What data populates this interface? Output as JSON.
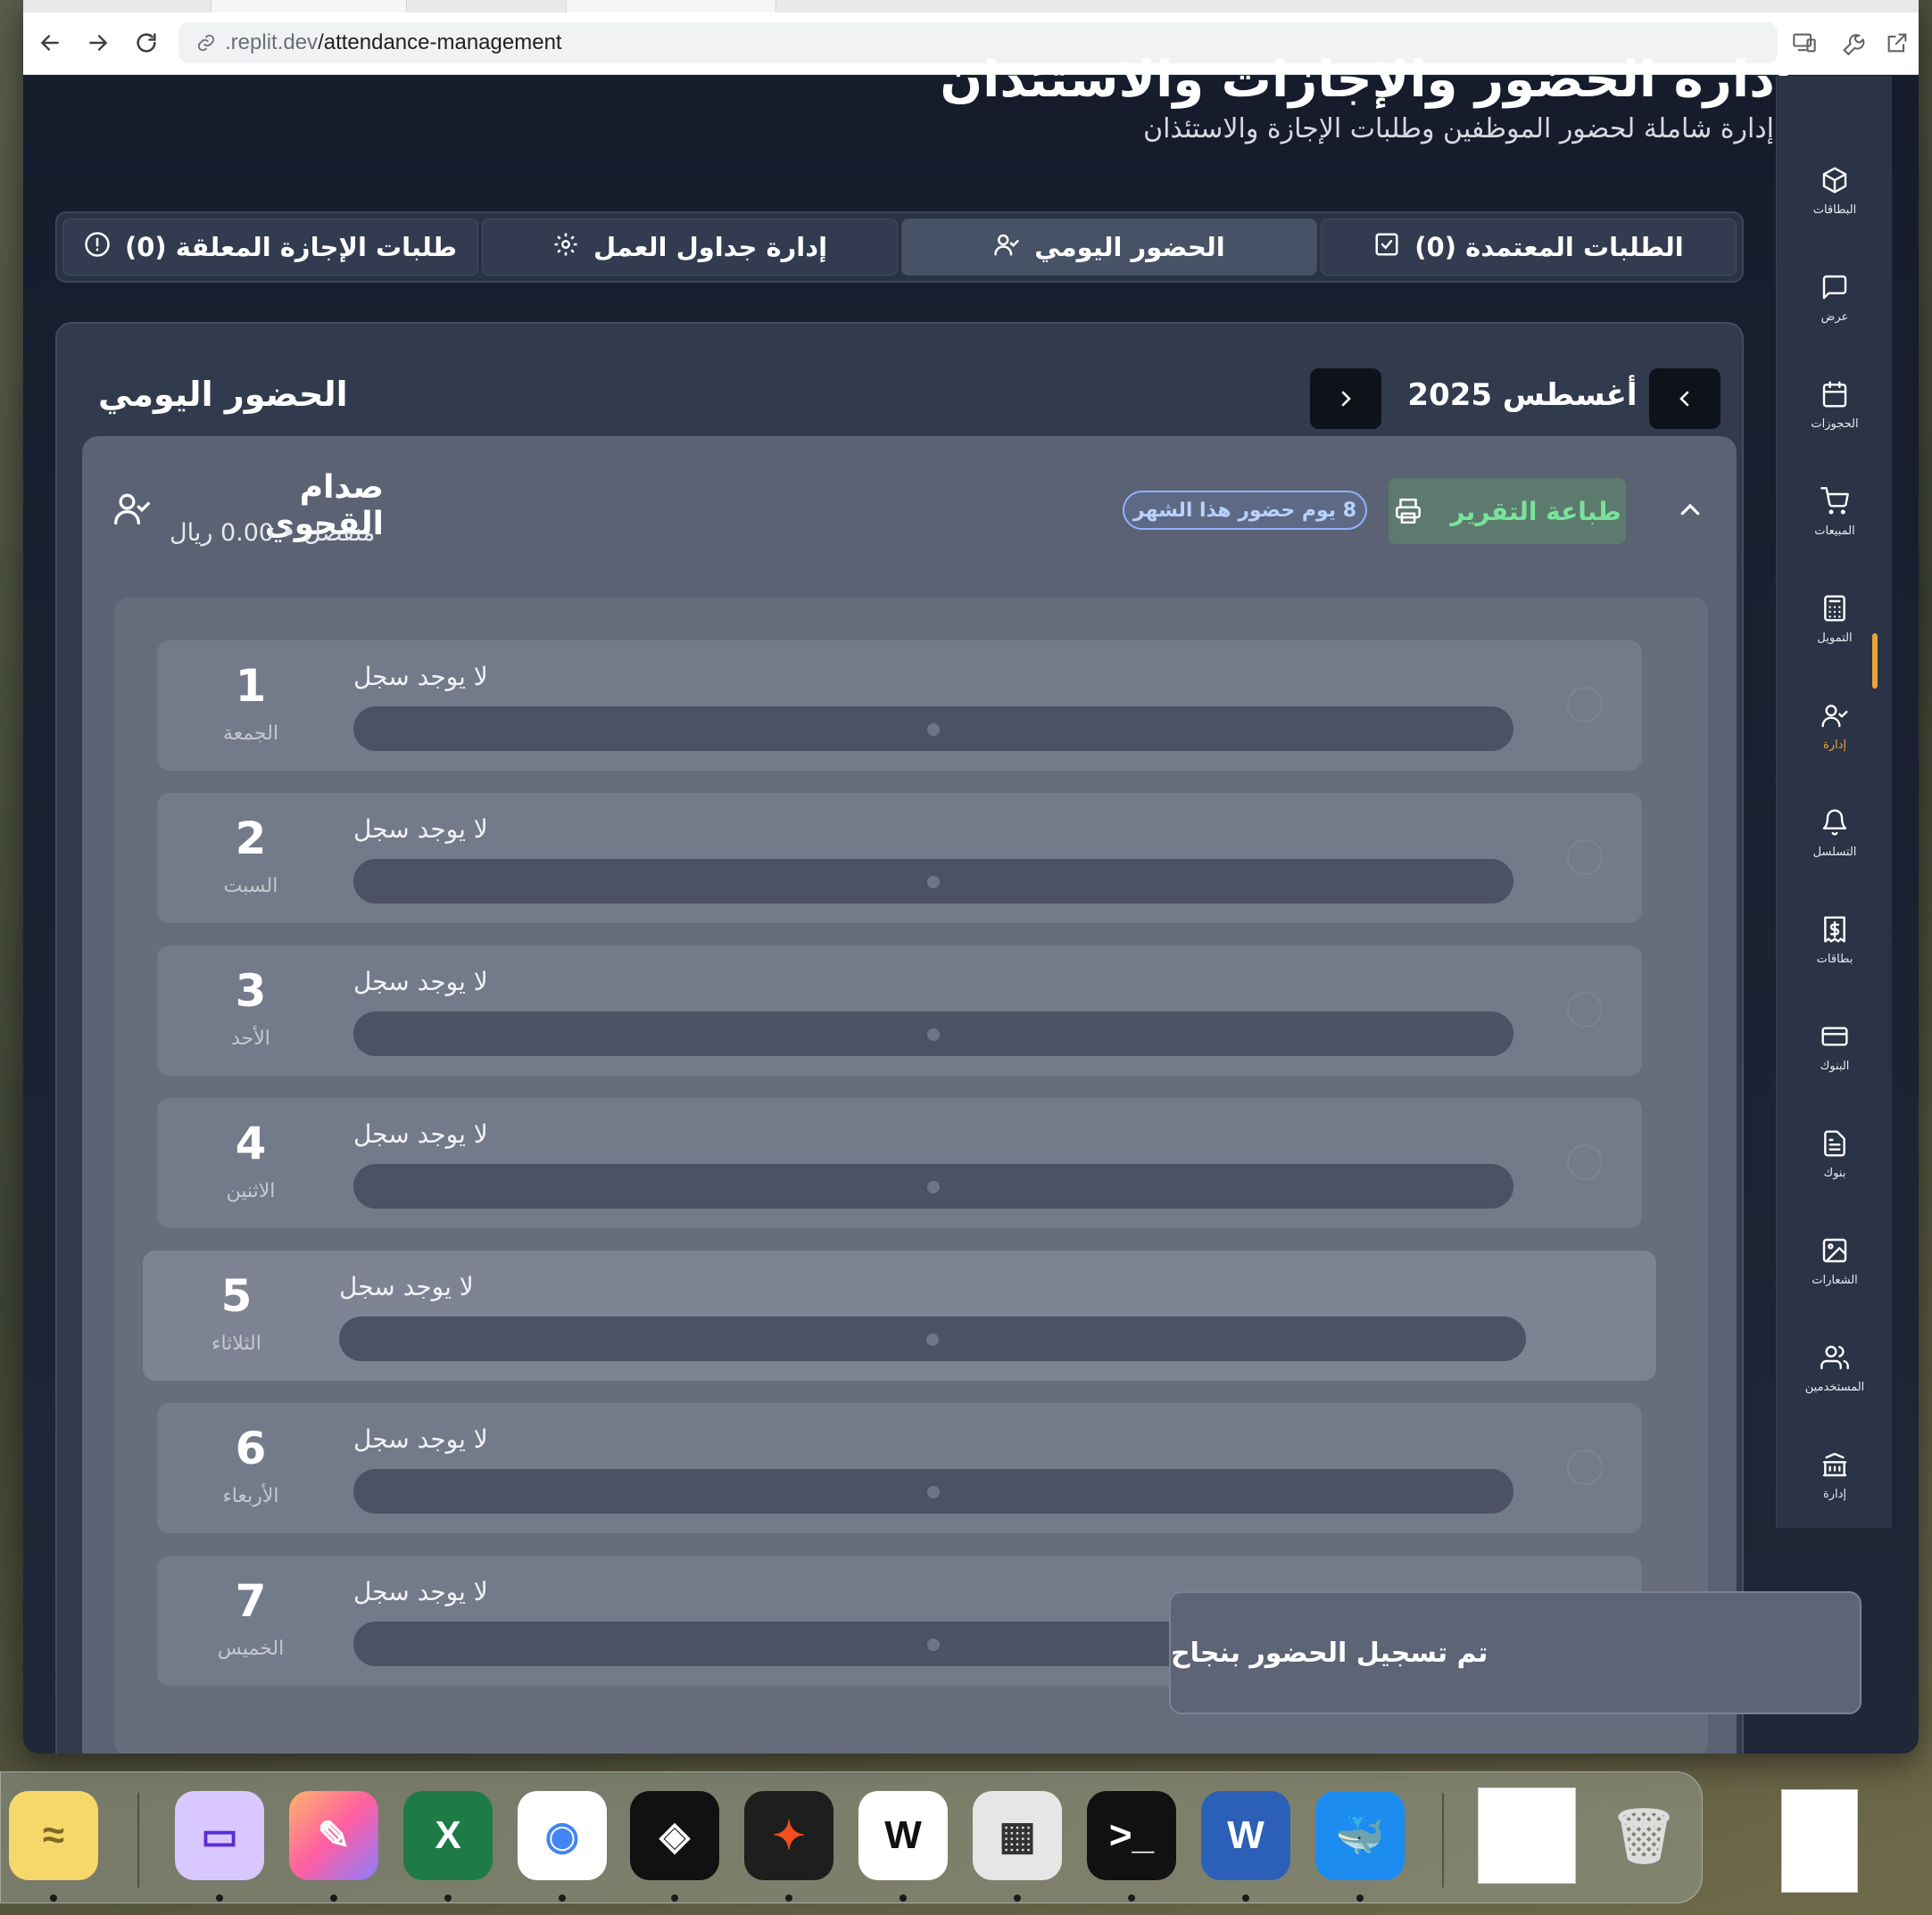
{
  "browser": {
    "url_host": ".replit.dev",
    "url_path": "/attendance-management"
  },
  "header": {
    "title": "إدارة الحضور والإجازات والاستئذان",
    "subtitle": "إدارة شاملة لحضور الموظفين وطلبات الإجازة والاستئذان"
  },
  "tabs": [
    {
      "label": "الطلبات المعتمدة (0)",
      "icon": "check-square-icon",
      "active": false
    },
    {
      "label": "الحضور اليومي",
      "icon": "user-check-icon",
      "active": true
    },
    {
      "label": "إدارة جداول العمل",
      "icon": "gear-icon",
      "active": false
    },
    {
      "label": "طلبات الإجازة المعلقة (0)",
      "icon": "alert-circle-icon",
      "active": false
    }
  ],
  "card": {
    "title": "الحضور اليومي",
    "month_label": "أغسطس 2025"
  },
  "employee": {
    "name": "صدام القحوي",
    "meta": "منفصل • 0.00 ريال",
    "badge": "8 يوم حضور هذا الشهر",
    "print_label": "طباعة التقرير"
  },
  "days": [
    {
      "num": "1",
      "name": "الجمعة",
      "status": "لا يوجد سجل"
    },
    {
      "num": "2",
      "name": "السبت",
      "status": "لا يوجد سجل"
    },
    {
      "num": "3",
      "name": "الأحد",
      "status": "لا يوجد سجل"
    },
    {
      "num": "4",
      "name": "الاثنين",
      "status": "لا يوجد سجل"
    },
    {
      "num": "5",
      "name": "الثلاثاء",
      "status": "لا يوجد سجل"
    },
    {
      "num": "6",
      "name": "الأربعاء",
      "status": "لا يوجد سجل"
    },
    {
      "num": "7",
      "name": "الخميس",
      "status": "لا يوجد سجل"
    }
  ],
  "sidebar": {
    "items": [
      {
        "label": "البطاقات",
        "icon": "package-icon"
      },
      {
        "label": "عرض",
        "icon": "message-square-icon"
      },
      {
        "label": "الحجوزات",
        "icon": "calendar-icon"
      },
      {
        "label": "المبيعات",
        "icon": "cart-icon"
      },
      {
        "label": "التمويل",
        "icon": "calculator-icon"
      },
      {
        "label": "إدارة",
        "icon": "user-check-icon",
        "active": true
      },
      {
        "label": "التسلسل",
        "icon": "bell-icon"
      },
      {
        "label": "بطاقات",
        "icon": "receipt-icon"
      },
      {
        "label": "البنوك",
        "icon": "credit-card-icon"
      },
      {
        "label": "بنوك",
        "icon": "document-icon"
      },
      {
        "label": "الشعارات",
        "icon": "image-icon"
      },
      {
        "label": "المستخدمين",
        "icon": "users-icon"
      },
      {
        "label": "إدارة",
        "icon": "bank-icon"
      }
    ]
  },
  "toast": {
    "message": "تم تسجيل الحضور بنجاح"
  },
  "dock": {
    "apps": [
      "Stickies",
      "Screens",
      "Pages",
      "Excel",
      "Chrome",
      "Unity",
      "Figma",
      "Wordform",
      "Calculator",
      "Terminal",
      "Word",
      "Docker"
    ]
  },
  "colors": {
    "accent_active": "#e8a43b",
    "badge_blue": "#8fb3ff",
    "print_green": "#79e39a"
  }
}
